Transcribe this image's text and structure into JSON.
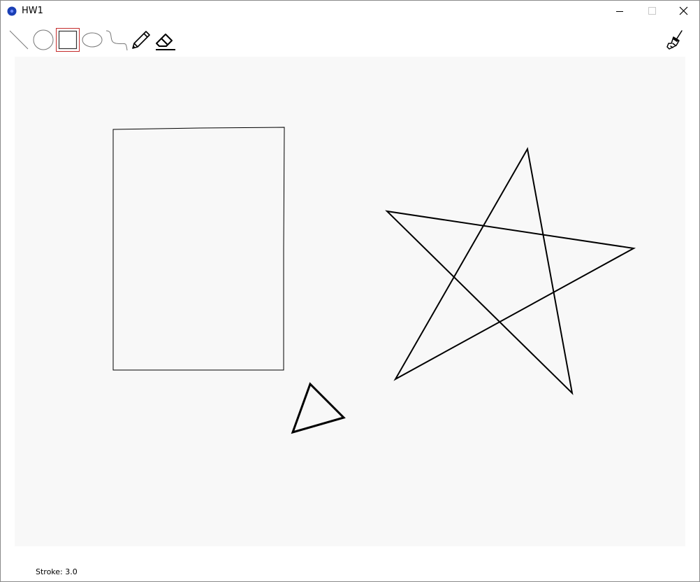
{
  "window": {
    "title": "HW1",
    "app_icon": "app-globe-icon",
    "controls": {
      "minimize_icon": "minimize-icon",
      "maximize_icon": "maximize-icon",
      "close_icon": "close-icon"
    }
  },
  "toolbar": {
    "selected_tool": "rectangle",
    "tools": [
      {
        "id": "line",
        "icon": "line-tool-icon"
      },
      {
        "id": "circle",
        "icon": "circle-tool-icon"
      },
      {
        "id": "rectangle",
        "icon": "rectangle-tool-icon"
      },
      {
        "id": "ellipse",
        "icon": "ellipse-tool-icon"
      },
      {
        "id": "curve",
        "icon": "curve-tool-icon"
      },
      {
        "id": "pencil",
        "icon": "pencil-icon"
      },
      {
        "id": "eraser",
        "icon": "eraser-icon"
      }
    ],
    "clear_tool": {
      "id": "clear",
      "icon": "broom-icon"
    }
  },
  "canvas": {
    "background_color": "#f8f8f8",
    "stroke_color": "#000000",
    "shapes": [
      "rectangle",
      "star",
      "triangle"
    ]
  },
  "status": {
    "stroke_text": "Stroke: 3.0"
  },
  "colors": {
    "selected_border": "#c42b2b",
    "app_icon_blue": "#1a3fb5"
  }
}
